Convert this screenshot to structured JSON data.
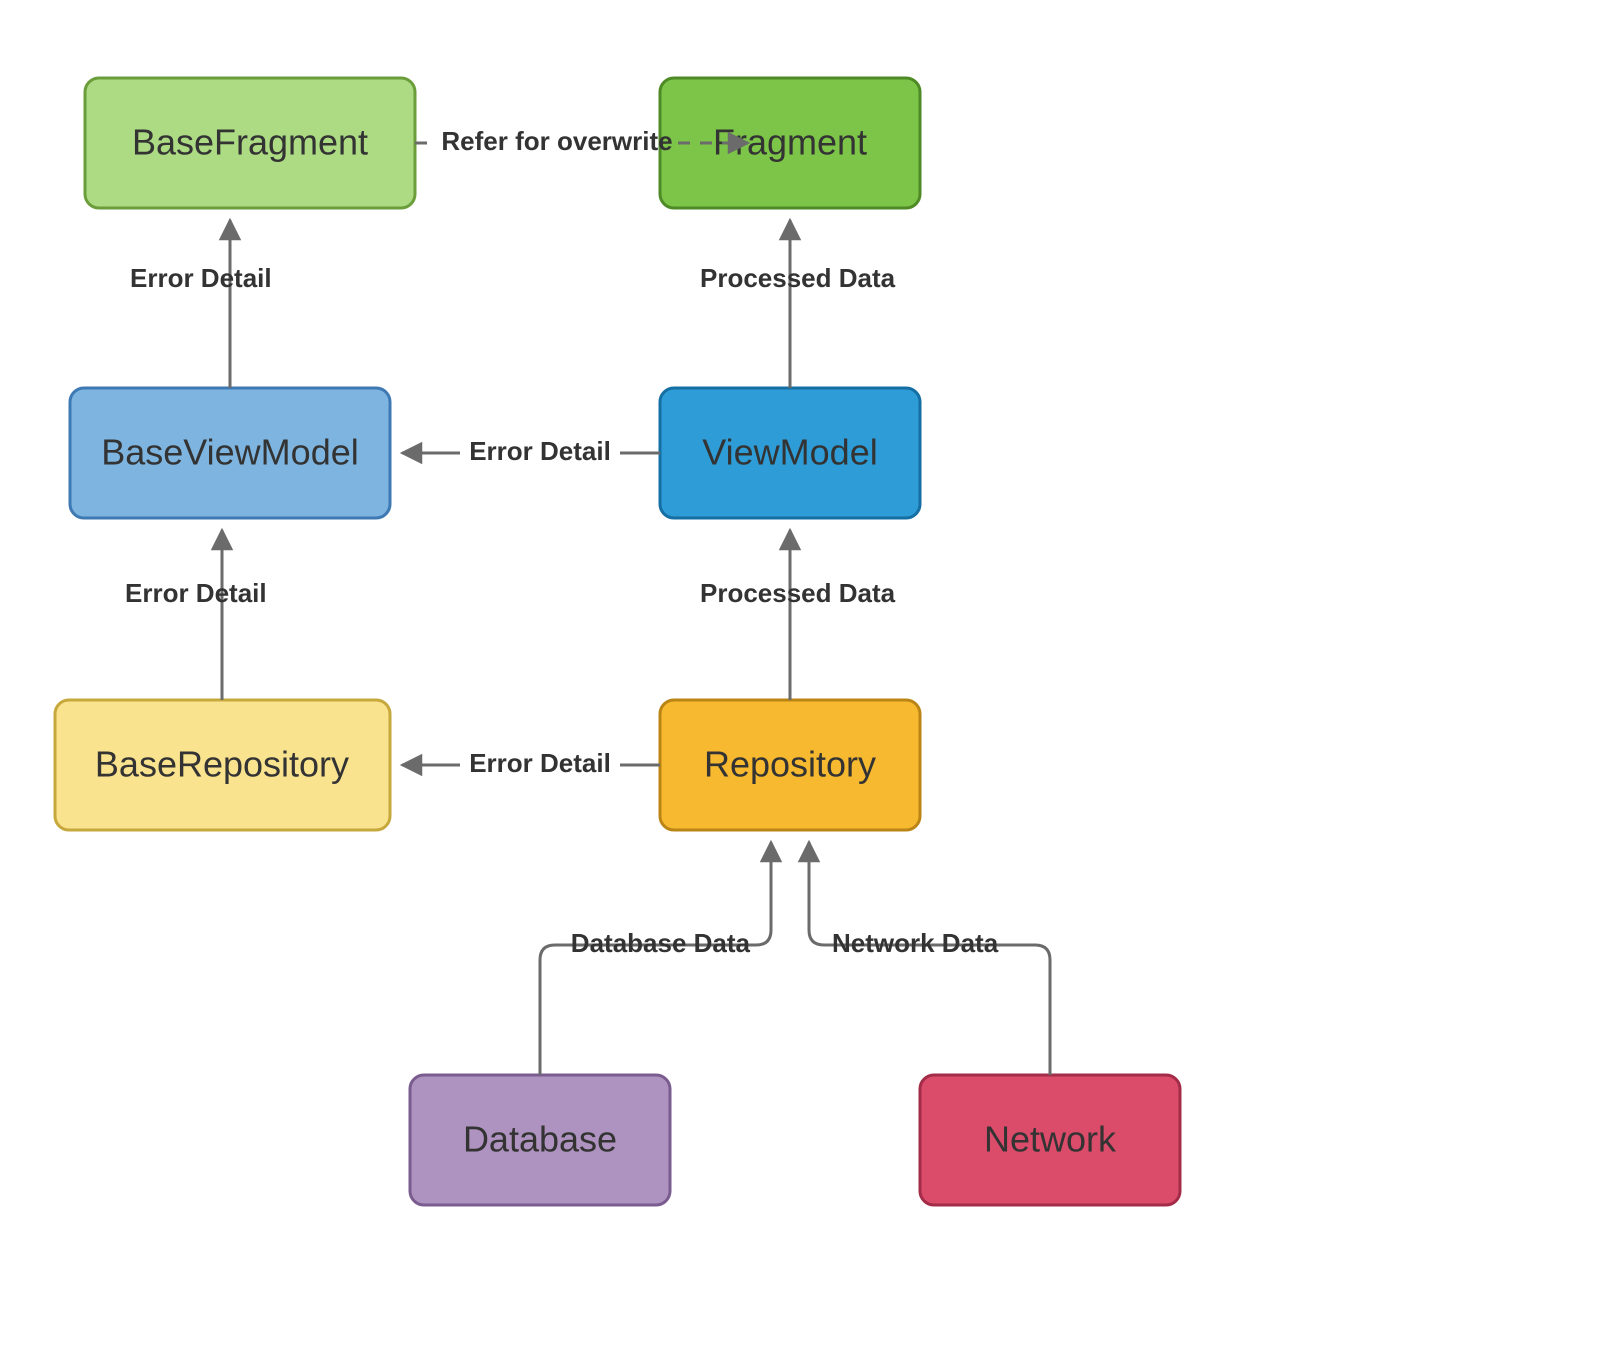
{
  "diagram": {
    "nodes": {
      "baseFragment": {
        "label": "BaseFragment",
        "fill": "#ACDB84",
        "stroke": "#6B9E3B"
      },
      "fragment": {
        "label": "Fragment",
        "fill": "#7DC549",
        "stroke": "#4E8A26"
      },
      "baseViewModel": {
        "label": "BaseViewModel",
        "fill": "#7EB5E0",
        "stroke": "#3E79B3"
      },
      "viewModel": {
        "label": "ViewModel",
        "fill": "#2E9CD6",
        "stroke": "#156FA3"
      },
      "baseRepository": {
        "label": "BaseRepository",
        "fill": "#FAE38E",
        "stroke": "#C6A83C"
      },
      "repository": {
        "label": "Repository",
        "fill": "#F6B92F",
        "stroke": "#BB8516"
      },
      "database": {
        "label": "Database",
        "fill": "#AE92BF",
        "stroke": "#7A5C8F"
      },
      "network": {
        "label": "Network",
        "fill": "#DB4B6A",
        "stroke": "#A32C48"
      }
    },
    "edges": {
      "referForOverwrite": "Refer for overwrite",
      "errorDetail": "Error Detail",
      "processedData": "Processed Data",
      "databaseData": "Database Data",
      "networkData": "Network Data"
    }
  }
}
